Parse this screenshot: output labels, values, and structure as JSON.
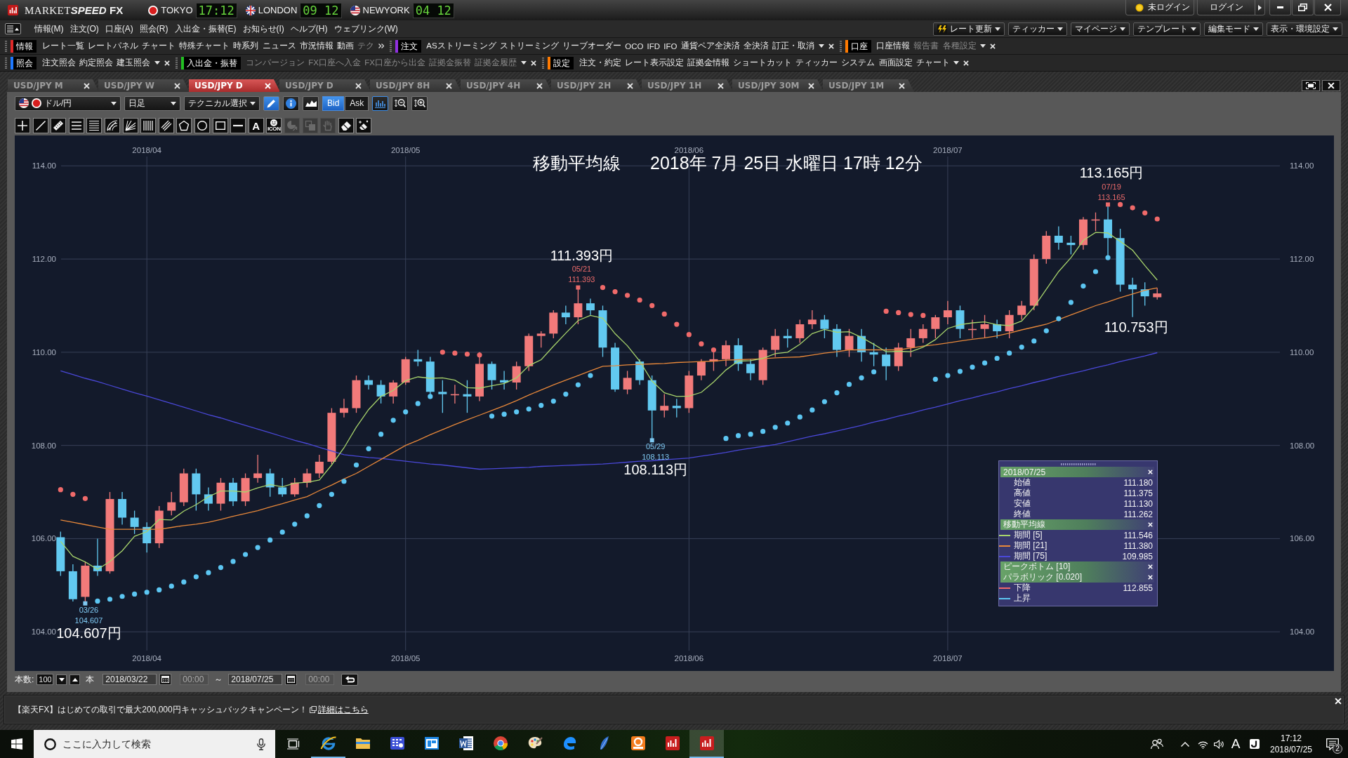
{
  "title_bar": {
    "app_name": [
      "MARKET",
      "SPEED",
      "FX"
    ],
    "clocks": [
      {
        "city": "TOKYO",
        "time": "17:12"
      },
      {
        "city": "LONDON",
        "time": "09 12"
      },
      {
        "city": "NEWYORK",
        "time": "04 12"
      }
    ],
    "login_status": "未ログイン",
    "login_button": "ログイン"
  },
  "menu": {
    "items": [
      "情報(M)",
      "注文(O)",
      "口座(A)",
      "照会(R)",
      "入出金・振替(E)",
      "お知らせ(I)",
      "ヘルプ(H)",
      "ウェブリンク(W)"
    ],
    "quick_buttons": [
      "レート更新",
      "ティッカー",
      "マイページ",
      "テンプレート",
      "編集モード",
      "表示・環境設定"
    ]
  },
  "toolbars": [
    [
      {
        "title": "情報",
        "color": "#e02828",
        "truncated": true,
        "items": [
          {
            "label": "レート一覧",
            "disabled": false
          },
          {
            "label": "レートパネル",
            "disabled": false
          },
          {
            "label": "チャート",
            "disabled": false
          },
          {
            "label": "特殊チャート",
            "disabled": false
          },
          {
            "label": "時系列",
            "disabled": false
          },
          {
            "label": "ニュース",
            "disabled": false
          },
          {
            "label": "市況情報",
            "disabled": false
          },
          {
            "label": "動画",
            "disabled": false
          },
          {
            "label": "テク",
            "disabled": true
          }
        ]
      },
      {
        "title": "注文",
        "color": "#9030e0",
        "truncated": false,
        "items": [
          {
            "label": "ASストリーミング",
            "disabled": false
          },
          {
            "label": "ストリーミング",
            "disabled": false
          },
          {
            "label": "リーブオーダー",
            "disabled": false
          },
          {
            "label": "OCO",
            "disabled": false
          },
          {
            "label": "IFD",
            "disabled": false
          },
          {
            "label": "IFO",
            "disabled": false
          },
          {
            "label": "通貨ペア全決済",
            "disabled": false
          },
          {
            "label": "全決済",
            "disabled": false
          },
          {
            "label": "訂正・取消",
            "disabled": false
          }
        ]
      },
      {
        "title": "口座",
        "color": "#ff7a00",
        "truncated": false,
        "items": [
          {
            "label": "口座情報",
            "disabled": false
          },
          {
            "label": "報告書",
            "disabled": true
          },
          {
            "label": "各種設定",
            "disabled": true
          }
        ]
      }
    ],
    [
      {
        "title": "照会",
        "color": "#1e78ff",
        "truncated": false,
        "items": [
          {
            "label": "注文照会",
            "disabled": false
          },
          {
            "label": "約定照会",
            "disabled": false
          },
          {
            "label": "建玉照会",
            "disabled": false
          }
        ]
      },
      {
        "title": "入出金・振替",
        "color": "#22c022",
        "truncated": false,
        "items": [
          {
            "label": "コンバージョン",
            "disabled": true
          },
          {
            "label": "FX口座へ入金",
            "disabled": true
          },
          {
            "label": "FX口座から出金",
            "disabled": true
          },
          {
            "label": "証拠金振替",
            "disabled": true
          },
          {
            "label": "証拠金履歴",
            "disabled": true
          }
        ]
      },
      {
        "title": "設定",
        "color": "#ff7a00",
        "truncated": false,
        "items": [
          {
            "label": "注文・約定",
            "disabled": false
          },
          {
            "label": "レート表示設定",
            "disabled": false
          },
          {
            "label": "証拠金情報",
            "disabled": false
          },
          {
            "label": "ショートカット",
            "disabled": false
          },
          {
            "label": "ティッカー",
            "disabled": false
          },
          {
            "label": "システム",
            "disabled": false
          },
          {
            "label": "画面設定",
            "disabled": false
          },
          {
            "label": "チャート",
            "disabled": false
          }
        ]
      }
    ]
  ],
  "chart_tabs": [
    {
      "label": "USD/JPY M",
      "selected": false
    },
    {
      "label": "USD/JPY W",
      "selected": false
    },
    {
      "label": "USD/JPY D",
      "selected": true
    },
    {
      "label": "USD/JPY D",
      "selected": false
    },
    {
      "label": "USD/JPY 8H",
      "selected": false
    },
    {
      "label": "USD/JPY 4H",
      "selected": false
    },
    {
      "label": "USD/JPY 2H",
      "selected": false
    },
    {
      "label": "USD/JPY 1H",
      "selected": false
    },
    {
      "label": "USD/JPY 30M",
      "selected": false
    },
    {
      "label": "USD/JPY 1M",
      "selected": false
    }
  ],
  "chart_toolbar": {
    "pair": "ドル/円",
    "period": "日足",
    "technical": "テクニカル選択",
    "price_modes": [
      {
        "label": "Bid",
        "selected": true
      },
      {
        "label": "Ask",
        "selected": false
      }
    ]
  },
  "drawing_tools": [
    {
      "kind": "crosshair",
      "disabled": false
    },
    {
      "kind": "line",
      "disabled": false
    },
    {
      "kind": "ruler",
      "disabled": false
    },
    {
      "kind": "lines3",
      "disabled": false
    },
    {
      "kind": "lines5",
      "disabled": false
    },
    {
      "kind": "arcfan",
      "disabled": false
    },
    {
      "kind": "linefan",
      "disabled": false
    },
    {
      "kind": "vlines",
      "disabled": false
    },
    {
      "kind": "channel",
      "disabled": false
    },
    {
      "kind": "pentagon",
      "disabled": false
    },
    {
      "kind": "circle",
      "disabled": false
    },
    {
      "kind": "rect",
      "disabled": false
    },
    {
      "kind": "hline",
      "disabled": false
    },
    {
      "kind": "text",
      "label": "A",
      "disabled": false
    },
    {
      "kind": "stamp",
      "label": "ICON",
      "disabled": false
    },
    {
      "kind": "pointer",
      "disabled": true
    },
    {
      "kind": "copy",
      "disabled": true
    },
    {
      "kind": "hand",
      "disabled": true
    },
    {
      "kind": "eraser",
      "disabled": false
    },
    {
      "kind": "cleaner",
      "disabled": false
    }
  ],
  "chart": {
    "timestamp": "2018年 7月 25日 水曜日 17時 12分",
    "right_axis": [
      "114.00",
      "112.00",
      "110.00",
      "108.00",
      "106.00",
      "104.00"
    ],
    "bottom_axis": [
      "2018/04",
      "2018/05",
      "2018/06",
      "2018/07"
    ],
    "chart_data": {
      "type": "candlestick",
      "title": "移動平均線",
      "grid": true,
      "ylim": [
        104,
        114
      ],
      "yticks": [
        {
          "value": 114,
          "label": "114.00"
        },
        {
          "value": 112,
          "label": "112.00"
        },
        {
          "value": 110,
          "label": "110.00"
        },
        {
          "value": 108,
          "label": "108.00"
        },
        {
          "value": 106,
          "label": "106.00"
        },
        {
          "value": 104,
          "label": "104.00"
        }
      ],
      "categories": [
        null,
        null,
        null,
        null,
        null,
        null,
        null,
        "2018/04",
        null,
        null,
        null,
        null,
        null,
        null,
        null,
        null,
        null,
        null,
        null,
        null,
        null,
        null,
        null,
        null,
        null,
        null,
        null,
        null,
        "2018/05",
        null,
        null,
        null,
        null,
        null,
        null,
        null,
        null,
        null,
        null,
        null,
        null,
        null,
        null,
        null,
        null,
        null,
        null,
        null,
        null,
        null,
        null,
        "2018/06",
        null,
        null,
        null,
        null,
        null,
        null,
        null,
        null,
        null,
        null,
        null,
        null,
        null,
        null,
        null,
        null,
        null,
        null,
        null,
        null,
        "2018/07",
        null,
        null,
        null,
        null,
        null,
        null,
        null,
        null,
        null,
        null,
        null,
        null,
        null,
        null,
        null,
        null,
        null
      ],
      "ohlc": [
        [
          106.03,
          106.15,
          105.2,
          105.3
        ],
        [
          105.3,
          105.45,
          104.65,
          104.7
        ],
        [
          104.75,
          105.5,
          104.607,
          105.42
        ],
        [
          105.42,
          106.0,
          105.2,
          105.3
        ],
        [
          105.3,
          107.0,
          105.25,
          106.85
        ],
        [
          106.85,
          107.0,
          106.3,
          106.45
        ],
        [
          106.45,
          106.6,
          106.1,
          106.25
        ],
        [
          106.25,
          106.35,
          105.7,
          105.9
        ],
        [
          105.9,
          106.7,
          105.8,
          106.6
        ],
        [
          106.6,
          107.0,
          106.5,
          106.78
        ],
        [
          106.78,
          107.5,
          106.7,
          107.4
        ],
        [
          107.4,
          107.5,
          106.6,
          106.95
        ],
        [
          106.95,
          107.1,
          106.6,
          106.75
        ],
        [
          106.75,
          107.3,
          106.6,
          107.2
        ],
        [
          107.2,
          107.3,
          106.7,
          106.8
        ],
        [
          106.8,
          107.4,
          106.7,
          107.3
        ],
        [
          107.3,
          107.8,
          107.2,
          107.4
        ],
        [
          107.4,
          107.5,
          106.9,
          107.1
        ],
        [
          107.1,
          107.3,
          106.9,
          106.95
        ],
        [
          106.95,
          107.3,
          106.9,
          107.2
        ],
        [
          107.2,
          107.5,
          107.1,
          107.4
        ],
        [
          107.4,
          107.8,
          107.3,
          107.65
        ],
        [
          107.65,
          108.8,
          107.6,
          108.7
        ],
        [
          108.7,
          109.0,
          108.6,
          108.8
        ],
        [
          108.8,
          109.5,
          108.7,
          109.4
        ],
        [
          109.4,
          109.5,
          109.2,
          109.3
        ],
        [
          109.3,
          109.4,
          108.9,
          109.05
        ],
        [
          109.05,
          109.4,
          108.9,
          109.35
        ],
        [
          109.35,
          109.9,
          109.3,
          109.85
        ],
        [
          109.85,
          110.05,
          109.7,
          109.8
        ],
        [
          109.8,
          109.9,
          109.0,
          109.15
        ],
        [
          109.15,
          109.4,
          108.7,
          109.1
        ],
        [
          109.1,
          109.3,
          108.9,
          109.1
        ],
        [
          109.1,
          109.4,
          108.7,
          109.05
        ],
        [
          109.05,
          110.0,
          108.95,
          109.75
        ],
        [
          109.75,
          109.8,
          109.2,
          109.4
        ],
        [
          109.4,
          109.6,
          109.2,
          109.35
        ],
        [
          109.35,
          109.8,
          109.2,
          109.7
        ],
        [
          109.7,
          110.4,
          109.6,
          110.35
        ],
        [
          110.35,
          110.45,
          110.1,
          110.4
        ],
        [
          110.4,
          110.9,
          110.3,
          110.85
        ],
        [
          110.85,
          111.0,
          110.6,
          110.75
        ],
        [
          110.75,
          111.393,
          110.6,
          111.05
        ],
        [
          111.05,
          111.15,
          110.8,
          110.9
        ],
        [
          110.9,
          111.0,
          109.9,
          110.1
        ],
        [
          110.1,
          110.2,
          109.15,
          109.2
        ],
        [
          109.2,
          109.6,
          109.1,
          109.45
        ],
        [
          109.8,
          109.85,
          109.3,
          109.4
        ],
        [
          109.4,
          109.5,
          108.113,
          108.75
        ],
        [
          108.75,
          109.1,
          108.6,
          108.85
        ],
        [
          108.85,
          109.0,
          108.6,
          108.8
        ],
        [
          108.8,
          109.6,
          108.7,
          109.5
        ],
        [
          109.5,
          109.85,
          109.4,
          109.8
        ],
        [
          109.8,
          110.0,
          109.6,
          109.85
        ],
        [
          109.85,
          110.25,
          109.7,
          110.15
        ],
        [
          110.15,
          110.3,
          109.6,
          109.75
        ],
        [
          109.75,
          109.85,
          109.4,
          109.55
        ],
        [
          109.4,
          110.1,
          109.3,
          110.05
        ],
        [
          110.05,
          110.5,
          109.9,
          110.35
        ],
        [
          110.35,
          110.5,
          110.1,
          110.3
        ],
        [
          110.3,
          110.7,
          110.2,
          110.6
        ],
        [
          110.6,
          110.9,
          110.5,
          110.7
        ],
        [
          110.7,
          110.8,
          110.3,
          110.5
        ],
        [
          110.5,
          110.6,
          109.9,
          110.05
        ],
        [
          110.05,
          110.5,
          109.9,
          110.35
        ],
        [
          110.35,
          110.5,
          109.8,
          110.0
        ],
        [
          110.0,
          110.2,
          109.7,
          109.95
        ],
        [
          109.95,
          110.1,
          109.4,
          109.7
        ],
        [
          109.7,
          110.2,
          109.6,
          110.1
        ],
        [
          110.1,
          110.5,
          109.9,
          110.3
        ],
        [
          110.3,
          110.6,
          110.2,
          110.5
        ],
        [
          110.5,
          110.8,
          110.3,
          110.75
        ],
        [
          110.75,
          111.1,
          110.6,
          110.9
        ],
        [
          110.9,
          111.0,
          110.3,
          110.5
        ],
        [
          110.5,
          110.7,
          110.3,
          110.5
        ],
        [
          110.5,
          110.8,
          110.3,
          110.6
        ],
        [
          110.6,
          110.7,
          110.3,
          110.45
        ],
        [
          110.45,
          110.9,
          110.3,
          110.8
        ],
        [
          110.8,
          111.1,
          110.7,
          111.0
        ],
        [
          111.0,
          112.1,
          110.9,
          112.0
        ],
        [
          112.0,
          112.6,
          111.9,
          112.5
        ],
        [
          112.5,
          112.7,
          112.2,
          112.35
        ],
        [
          112.35,
          112.5,
          112.1,
          112.3
        ],
        [
          112.3,
          112.9,
          112.2,
          112.85
        ],
        [
          112.85,
          113.0,
          112.6,
          112.85
        ],
        [
          112.85,
          113.165,
          112.0,
          112.45
        ],
        [
          112.45,
          112.65,
          111.3,
          111.45
        ],
        [
          111.45,
          111.6,
          110.753,
          111.35
        ],
        [
          111.35,
          111.5,
          111.0,
          111.2
        ],
        [
          111.18,
          111.375,
          111.13,
          111.262
        ]
      ],
      "series": [
        {
          "type": "line",
          "color": "#4a48d8",
          "values": [
            109.6,
            109.52,
            109.44,
            109.37,
            109.29,
            109.21,
            109.13,
            109.06,
            108.98,
            108.9,
            108.82,
            108.74,
            108.66,
            108.59,
            108.51,
            108.43,
            108.35,
            108.27,
            108.19,
            108.11,
            108.04,
            107.96,
            107.88,
            107.8,
            107.77,
            107.74,
            107.72,
            107.69,
            107.66,
            107.63,
            107.6,
            107.58,
            107.55,
            107.52,
            107.49,
            107.5,
            107.51,
            107.52,
            107.53,
            107.55,
            107.56,
            107.57,
            107.58,
            107.59,
            107.6,
            107.62,
            107.64,
            107.66,
            107.67,
            107.69,
            107.71,
            107.73,
            107.77,
            107.81,
            107.85,
            107.9,
            107.94,
            107.98,
            108.02,
            108.08,
            108.14,
            108.2,
            108.25,
            108.31,
            108.37,
            108.43,
            108.5,
            108.56,
            108.63,
            108.69,
            108.76,
            108.82,
            108.89,
            108.96,
            109.02,
            109.09,
            109.15,
            109.22,
            109.28,
            109.35,
            109.41,
            109.48,
            109.54,
            109.6,
            109.67,
            109.73,
            109.8,
            109.86,
            109.92,
            109.99
          ]
        },
        {
          "type": "line",
          "color": "#e8883a",
          "values": [
            106.4,
            106.35,
            106.3,
            106.25,
            106.2,
            106.2,
            106.2,
            106.2,
            106.2,
            106.24,
            106.28,
            106.31,
            106.35,
            106.41,
            106.48,
            106.54,
            106.6,
            106.68,
            106.75,
            106.83,
            106.9,
            107.03,
            107.15,
            107.28,
            107.4,
            107.55,
            107.7,
            107.85,
            108.0,
            108.11,
            108.23,
            108.34,
            108.45,
            108.55,
            108.65,
            108.75,
            108.85,
            108.96,
            109.08,
            109.19,
            109.3,
            109.4,
            109.5,
            109.6,
            109.7,
            109.71,
            109.73,
            109.74,
            109.75,
            109.76,
            109.78,
            109.79,
            109.8,
            109.81,
            109.83,
            109.84,
            109.85,
            109.86,
            109.88,
            109.89,
            109.9,
            109.94,
            109.98,
            110.01,
            110.05,
            110.05,
            110.05,
            110.05,
            110.05,
            110.09,
            110.13,
            110.16,
            110.2,
            110.24,
            110.28,
            110.31,
            110.35,
            110.41,
            110.48,
            110.54,
            110.6,
            110.7,
            110.8,
            110.9,
            111.0,
            111.08,
            111.17,
            111.25,
            111.33,
            111.38
          ]
        },
        {
          "type": "line",
          "color": "#a8d46c",
          "values": [
            105.94,
            105.62,
            105.5,
            105.34,
            105.51,
            105.74,
            106.05,
            106.15,
            106.41,
            106.4,
            106.59,
            106.73,
            106.9,
            107.02,
            107.02,
            107.0,
            107.09,
            107.16,
            107.11,
            107.19,
            107.21,
            107.26,
            107.58,
            107.95,
            108.39,
            108.77,
            109.05,
            109.18,
            109.39,
            109.47,
            109.44,
            109.45,
            109.4,
            109.24,
            109.23,
            109.28,
            109.33,
            109.45,
            109.71,
            109.84,
            110.13,
            110.41,
            110.68,
            110.79,
            110.73,
            110.4,
            110.14,
            109.81,
            109.38,
            109.13,
            109.05,
            109.06,
            109.14,
            109.36,
            109.62,
            109.81,
            109.82,
            109.87,
            109.97,
            110.0,
            110.17,
            110.4,
            110.49,
            110.43,
            110.44,
            110.32,
            110.17,
            110.01,
            110.02,
            110.01,
            110.11,
            110.27,
            110.51,
            110.59,
            110.63,
            110.65,
            110.59,
            110.57,
            110.67,
            110.97,
            111.35,
            111.73,
            112.03,
            112.4,
            112.57,
            112.56,
            112.38,
            112.19,
            111.86,
            111.55
          ]
        },
        {
          "type": "scatter",
          "marker": "circle",
          "color": "#f06a6a",
          "values": [
            107.05,
            106.95,
            106.86,
            null,
            null,
            null,
            null,
            null,
            null,
            null,
            null,
            null,
            null,
            null,
            null,
            null,
            null,
            null,
            null,
            null,
            null,
            null,
            null,
            null,
            null,
            null,
            null,
            null,
            null,
            null,
            null,
            110.0,
            109.98,
            109.96,
            109.94,
            null,
            null,
            null,
            null,
            null,
            null,
            null,
            null,
            null,
            111.39,
            111.3,
            111.22,
            111.12,
            111.0,
            110.82,
            110.6,
            110.38,
            110.18,
            110.05,
            null,
            null,
            null,
            null,
            null,
            null,
            null,
            null,
            null,
            null,
            null,
            null,
            null,
            110.88,
            110.85,
            110.81,
            110.79,
            null,
            null,
            null,
            null,
            null,
            null,
            null,
            null,
            null,
            null,
            null,
            null,
            null,
            null,
            null,
            113.17,
            113.1,
            112.99,
            112.86
          ]
        },
        {
          "type": "scatter",
          "marker": "circle",
          "color": "#5cc6f2",
          "values": [
            null,
            null,
            null,
            104.66,
            104.7,
            104.76,
            104.81,
            104.85,
            104.9,
            104.98,
            105.07,
            105.18,
            105.27,
            105.38,
            105.51,
            105.66,
            105.81,
            105.97,
            106.14,
            106.31,
            106.49,
            106.71,
            106.95,
            107.23,
            107.58,
            107.93,
            108.24,
            108.54,
            108.72,
            108.9,
            109.05,
            null,
            null,
            null,
            null,
            108.63,
            108.67,
            108.72,
            108.78,
            108.86,
            108.95,
            109.1,
            109.3,
            109.5,
            null,
            null,
            null,
            null,
            null,
            null,
            null,
            null,
            null,
            null,
            108.15,
            108.21,
            108.24,
            108.3,
            108.39,
            108.48,
            108.61,
            108.76,
            108.94,
            109.13,
            109.31,
            109.45,
            109.58,
            null,
            null,
            null,
            null,
            109.42,
            109.5,
            109.59,
            109.68,
            109.77,
            109.87,
            109.98,
            110.11,
            110.24,
            110.46,
            110.72,
            111.07,
            111.42,
            111.73,
            112.03,
            null,
            null,
            null,
            null
          ]
        },
        {
          "type": "scatter",
          "marker": "square",
          "color": "#ec6b6b",
          "values": [
            null,
            null,
            null,
            null,
            null,
            null,
            null,
            null,
            null,
            null,
            null,
            null,
            null,
            null,
            null,
            null,
            null,
            null,
            null,
            null,
            null,
            null,
            null,
            null,
            null,
            null,
            null,
            null,
            null,
            null,
            null,
            null,
            null,
            null,
            null,
            null,
            null,
            null,
            null,
            null,
            null,
            null,
            111.39,
            null,
            null,
            null,
            null,
            null,
            null,
            null,
            null,
            null,
            null,
            null,
            null,
            null,
            null,
            null,
            null,
            null,
            null,
            null,
            null,
            null,
            null,
            null,
            null,
            null,
            null,
            null,
            null,
            null,
            null,
            null,
            null,
            null,
            null,
            null,
            null,
            null,
            null,
            null,
            null,
            null,
            null,
            113.17,
            null,
            null,
            null,
            null
          ]
        },
        {
          "type": "scatter",
          "marker": "square",
          "color": "#7fc9f2",
          "values": [
            null,
            null,
            104.61,
            null,
            null,
            null,
            null,
            null,
            null,
            null,
            null,
            null,
            null,
            null,
            null,
            null,
            null,
            null,
            null,
            null,
            null,
            null,
            null,
            null,
            null,
            null,
            null,
            null,
            null,
            null,
            null,
            null,
            null,
            null,
            null,
            null,
            null,
            null,
            null,
            null,
            null,
            null,
            null,
            null,
            null,
            null,
            null,
            null,
            108.11,
            null,
            null,
            null,
            null,
            null,
            null,
            null,
            null,
            null,
            null,
            null,
            null,
            null,
            null,
            null,
            null,
            null,
            null,
            null,
            null,
            null,
            null,
            null,
            null,
            null,
            null,
            null,
            null,
            null,
            null,
            null,
            null,
            null,
            null,
            null,
            null,
            null,
            null,
            null,
            null,
            null
          ]
        }
      ],
      "annotations": [
        {
          "y": 104.607,
          "text": "03/26"
        },
        {
          "y": 104.607,
          "text": "104.607"
        },
        {
          "y": 104.607,
          "text": "104.607円"
        },
        {
          "y": 111.393,
          "text": "111.393円"
        },
        {
          "y": 111.393,
          "text": "05/21"
        },
        {
          "y": 111.393,
          "text": "111.393"
        },
        {
          "y": 108.113,
          "text": "05/29"
        },
        {
          "y": 108.113,
          "text": "108.113"
        },
        {
          "y": 108.113,
          "text": "108.113円"
        },
        {
          "y": 113.165,
          "text": "113.165円"
        },
        {
          "y": 113.165,
          "text": "07/19"
        },
        {
          "y": 113.165,
          "text": "113.165"
        },
        {
          "y": 110.753,
          "text": "110.753円"
        }
      ]
    }
  },
  "info_panel": {
    "sections": [
      {
        "title": "2018/07/25",
        "rows": [
          {
            "label": "始値",
            "value": "111.180"
          },
          {
            "label": "高値",
            "value": "111.375"
          },
          {
            "label": "安値",
            "value": "111.130"
          },
          {
            "label": "終値",
            "value": "111.262"
          }
        ]
      },
      {
        "title": "移動平均線",
        "rows": [
          {
            "label": "期間 [5]",
            "value": "111.546",
            "color": "#a8d46c"
          },
          {
            "label": "期間 [21]",
            "value": "111.380",
            "color": "#e8883a"
          },
          {
            "label": "期間 [75]",
            "value": "109.985",
            "color": "#4a48d8"
          }
        ]
      },
      {
        "title": "ピークボトム [10]"
      },
      {
        "title": "パラボリック [0.020]",
        "rows": [
          {
            "label": "下降",
            "value": "112.855",
            "color": "#f06a6a"
          },
          {
            "label": "上昇",
            "color": "#5cc6f2"
          }
        ]
      }
    ]
  },
  "range_bar": {
    "count_label": "本数:",
    "count": "100",
    "unit": "本",
    "start_date": "2018/03/22",
    "start_time": {
      "value": "00:00",
      "disabled": true
    },
    "separator": "～",
    "end_date": "2018/07/25",
    "end_time": {
      "value": "00:00",
      "disabled": true
    }
  },
  "banner": {
    "text": "【楽天FX】はじめての取引で最大200,000円キャッシュバックキャンペーン！",
    "link": "詳細はこちら"
  },
  "taskbar": {
    "search_placeholder": "ここに入力して検索",
    "apps": [
      {
        "open": true,
        "active": false
      },
      {
        "open": false,
        "active": false
      },
      {
        "open": false,
        "active": false
      },
      {
        "open": false,
        "active": false
      },
      {
        "open": false,
        "active": false
      },
      {
        "open": false,
        "active": false
      },
      {
        "open": false,
        "active": false
      },
      {
        "open": false,
        "active": false
      },
      {
        "open": false,
        "active": false
      },
      {
        "open": false,
        "active": false
      },
      {
        "open": false,
        "active": false
      },
      {
        "open": true,
        "active": true
      }
    ],
    "ime": "A",
    "time": "17:12",
    "date": "2018/07/25",
    "notifications": "2"
  }
}
